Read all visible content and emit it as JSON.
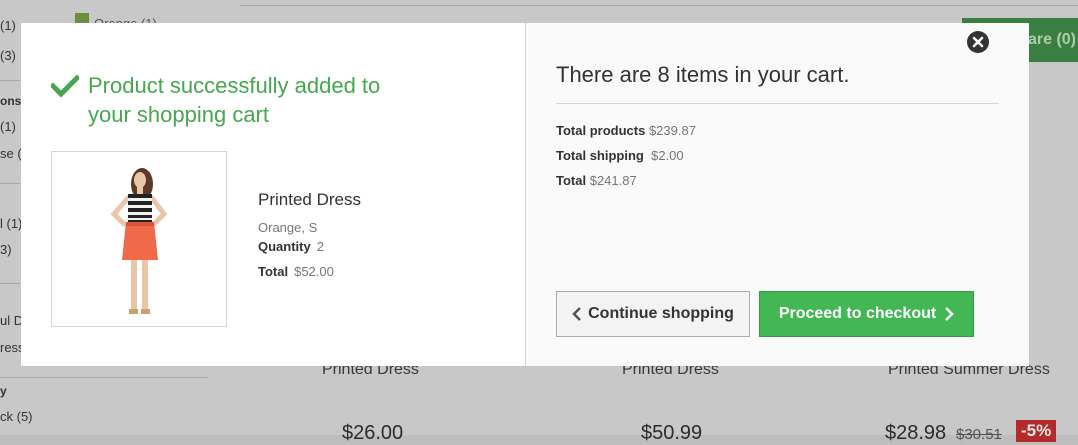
{
  "background": {
    "sidebar_texts": [
      "(1)",
      "(3)",
      "ons",
      "(1)",
      "se (2",
      "l (1)",
      "3)",
      "ul D",
      "ress",
      "y",
      "ck (5)"
    ],
    "swatch_label": "Orange (1)",
    "compare_button": "are (0)",
    "products": [
      {
        "title": "Printed Dress",
        "price": "$26.00"
      },
      {
        "title": "Printed Dress",
        "price": "$50.99"
      },
      {
        "title": "Printed Summer Dress",
        "price": "$28.98",
        "old_price": "$30.51",
        "discount": "-5%"
      }
    ]
  },
  "modal": {
    "success_message": "Product successfully added to your shopping cart",
    "product": {
      "name": "Printed Dress",
      "attributes": "Orange, S",
      "quantity_label": "Quantity",
      "quantity": "2",
      "total_label": "Total",
      "total": "$52.00",
      "image": "woman-in-orange-dress-photo"
    },
    "cart": {
      "title": "There are 8 items in your cart.",
      "total_products_label": "Total products",
      "total_products": "$239.87",
      "total_shipping_label": "Total shipping",
      "total_shipping": "$2.00",
      "total_label": "Total",
      "total": "$241.87"
    },
    "buttons": {
      "continue": "Continue shopping",
      "checkout": "Proceed to checkout"
    }
  },
  "colors": {
    "accent": "#46a74e",
    "checkout": "#43b754"
  }
}
